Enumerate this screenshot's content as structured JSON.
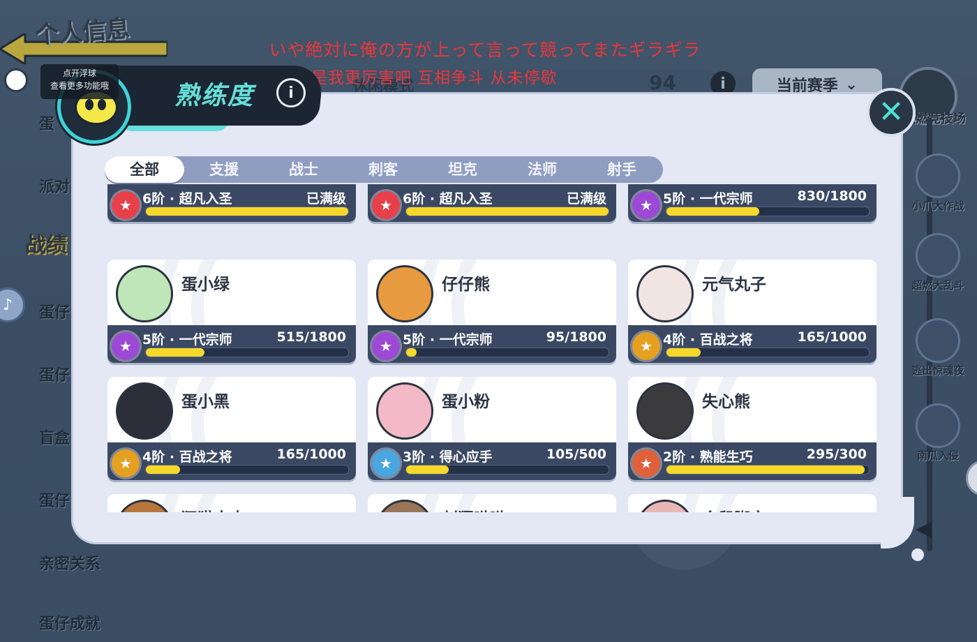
{
  "background": {
    "page_title": "个人信息",
    "sidebar_items": [
      "蛋",
      "派对",
      "战绩",
      "蛋仔",
      "蛋仔",
      "盲盒",
      "蛋仔",
      "亲密关系",
      "蛋仔成就"
    ],
    "mode_label": "休闲模式",
    "score": "94",
    "season_button": "当前赛季",
    "arena_label": "激燃竞技场",
    "rail_items": [
      "小爪大作战",
      "超燃大乱斗",
      "逃出惊魂夜",
      "南瓜入侵"
    ]
  },
  "subtitles": {
    "line1": "いや絶対に俺の方が上って言って競ってまたギラギラ",
    "line2": "不对  绝对是我更厉害吧  互相争斗  从未停歇"
  },
  "float_ball": {
    "tip": "点开浮球\n查看更多功能哦"
  },
  "modal": {
    "title": "熟练度",
    "info_icon": "info-icon",
    "close_icon": "close-icon"
  },
  "tabs": [
    "全部",
    "支援",
    "战士",
    "刺客",
    "坦克",
    "法师",
    "射手"
  ],
  "active_tab": 0,
  "cards": [
    {
      "name": "",
      "rank": "6阶 · 超凡入圣",
      "progress": "已满级",
      "fill": 1.0,
      "badge_color": "#e8404a",
      "avatar_color": "#e6c06a"
    },
    {
      "name": "",
      "rank": "6阶 · 超凡入圣",
      "progress": "已满级",
      "fill": 1.0,
      "badge_color": "#e8404a",
      "avatar_color": "#3f63b8"
    },
    {
      "name": "",
      "rank": "5阶 · 一代宗师",
      "progress": "830/1800",
      "fill": 0.46,
      "badge_color": "#9c4ad6",
      "avatar_color": "#e46b6b"
    },
    {
      "name": "蛋小绿",
      "rank": "5阶 · 一代宗师",
      "progress": "515/1800",
      "fill": 0.29,
      "badge_color": "#9c4ad6",
      "avatar_color": "#bfe6b8"
    },
    {
      "name": "仔仔熊",
      "rank": "5阶 · 一代宗师",
      "progress": "95/1800",
      "fill": 0.05,
      "badge_color": "#9c4ad6",
      "avatar_color": "#e79a3f"
    },
    {
      "name": "元气丸子",
      "rank": "4阶 · 百战之将",
      "progress": "165/1000",
      "fill": 0.17,
      "badge_color": "#e6a020",
      "avatar_color": "#f1e5e2"
    },
    {
      "name": "蛋小黑",
      "rank": "4阶 · 百战之将",
      "progress": "165/1000",
      "fill": 0.17,
      "badge_color": "#e6a020",
      "avatar_color": "#2c2f3a"
    },
    {
      "name": "蛋小粉",
      "rank": "3阶 · 得心应手",
      "progress": "105/500",
      "fill": 0.21,
      "badge_color": "#4aa6e0",
      "avatar_color": "#f4b9c6"
    },
    {
      "name": "失心熊",
      "rank": "2阶 · 熟能生巧",
      "progress": "295/300",
      "fill": 0.98,
      "badge_color": "#e0603a",
      "avatar_color": "#3b3b3e"
    },
    {
      "name": "狸猫大大",
      "rank": "",
      "progress": "",
      "fill": 0,
      "badge_color": "#e6a020",
      "avatar_color": "#b9763c"
    },
    {
      "name": "刺猬呦呦",
      "rank": "",
      "progress": "",
      "fill": 0,
      "badge_color": "#e6a020",
      "avatar_color": "#9a7658"
    },
    {
      "name": "仓鼠脚宝",
      "rank": "",
      "progress": "",
      "fill": 0,
      "badge_color": "#e6a020",
      "avatar_color": "#e9b6b6"
    }
  ],
  "colors": {
    "accent": "#65e0da",
    "bar_fill": "#f6d82b",
    "subtitle": "#e8373b"
  }
}
